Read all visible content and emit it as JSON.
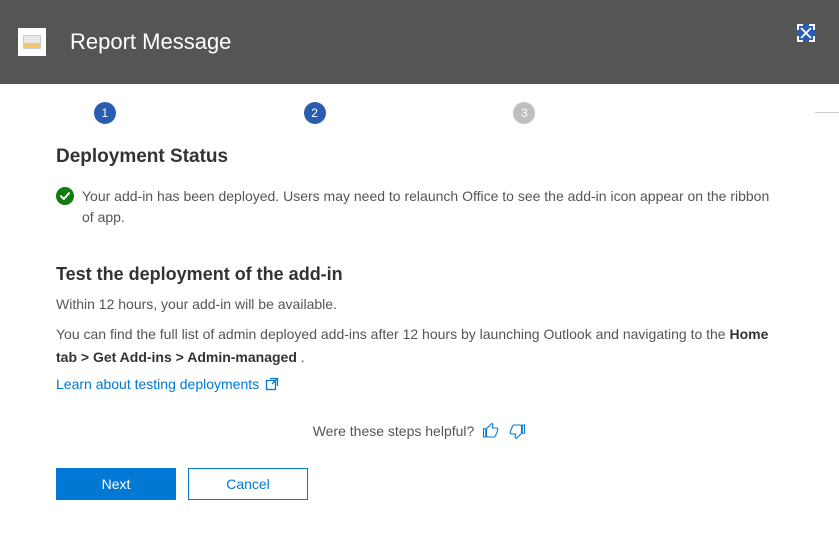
{
  "header": {
    "title": "Report Message"
  },
  "steps": {
    "items": [
      "1",
      "2",
      "3"
    ]
  },
  "status": {
    "heading": "Deployment Status",
    "text": "Your add-in has been deployed. Users may need to relaunch Office to see the add-in icon appear on the ribbon of app."
  },
  "test": {
    "heading": "Test the deployment of the add-in",
    "line1": "Within 12 hours, your add-in will be available.",
    "line2_pre": "You can find the full list of admin deployed add-ins after 12 hours by launching Outlook and navigating to the ",
    "line2_bold": "Home tab > Get Add-ins > Admin-managed",
    "line2_post": " .",
    "link": "Learn about testing deployments"
  },
  "feedback": {
    "prompt": "Were these steps helpful?"
  },
  "buttons": {
    "next": "Next",
    "cancel": "Cancel"
  }
}
